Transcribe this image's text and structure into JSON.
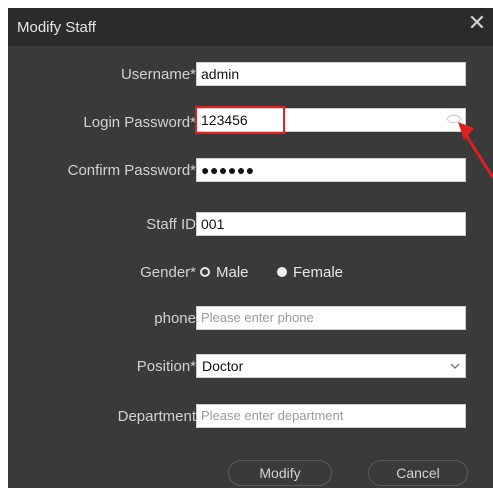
{
  "dialog": {
    "title": "Modify Staff",
    "close_glyph": "✕"
  },
  "form": {
    "username": {
      "label": "Username*",
      "value": "admin"
    },
    "login_password": {
      "label": "Login Password*",
      "value": "123456"
    },
    "confirm_password": {
      "label": "Confirm Password*",
      "value": "●●●●●●"
    },
    "staff_id": {
      "label": "Staff ID",
      "value": "001"
    },
    "gender": {
      "label": "Gender*",
      "options": [
        "Male",
        "Female"
      ],
      "selected": "Female"
    },
    "phone": {
      "label": "phone",
      "placeholder": "Please enter phone"
    },
    "position": {
      "label": "Position*",
      "value": "Doctor"
    },
    "department": {
      "label": "Department",
      "placeholder": "Please enter department"
    }
  },
  "buttons": {
    "modify": "Modify",
    "cancel": "Cancel"
  },
  "annotation": {
    "highlight_color": "#e02020",
    "icons": [
      "eye-icon",
      "arrow-icon"
    ]
  }
}
